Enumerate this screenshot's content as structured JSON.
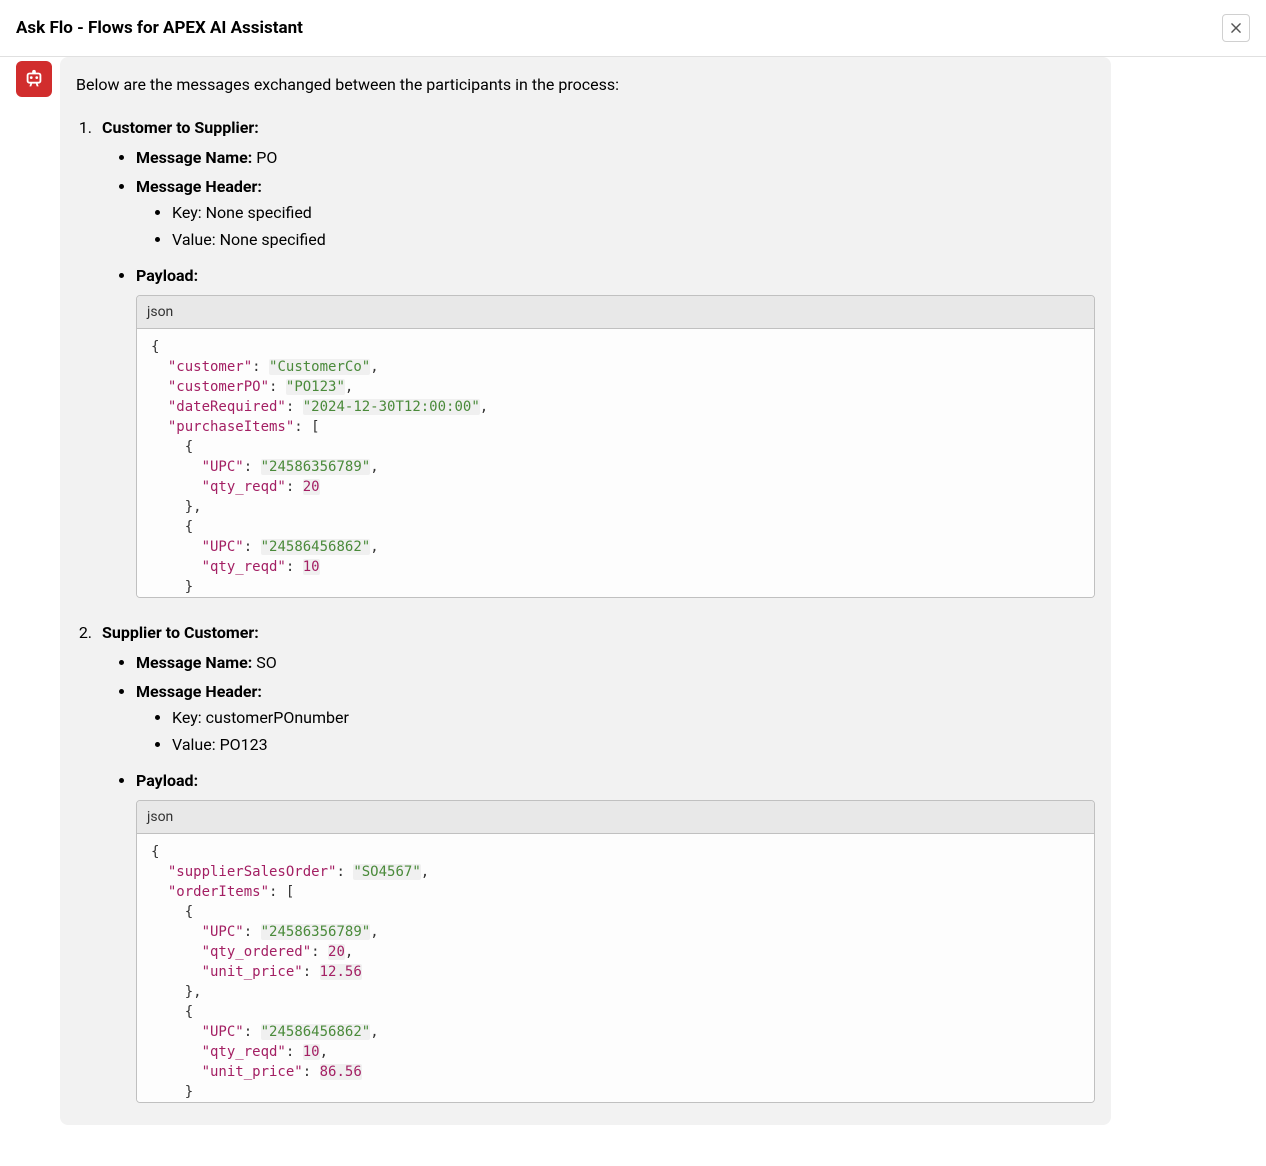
{
  "header": {
    "title": "Ask Flo - Flows for APEX AI Assistant"
  },
  "content": {
    "intro": "Below are the messages exchanged between the participants in the process:",
    "code_lang": "json",
    "labels": {
      "message_name": "Message Name:",
      "message_header": "Message Header:",
      "payload": "Payload:",
      "key_prefix": "Key:",
      "value_prefix": "Value:"
    },
    "messages": [
      {
        "title": "Customer to Supplier:",
        "name_value": "PO",
        "header_key": "None specified",
        "header_value": "None specified",
        "payload": {
          "customer": "CustomerCo",
          "customerPO": "PO123",
          "dateRequired": "2024-12-30T12:00:00",
          "purchaseItems": [
            {
              "UPC": "24586356789",
              "qty_reqd": 20
            },
            {
              "UPC": "24586456862",
              "qty_reqd": 10
            }
          ]
        }
      },
      {
        "title": "Supplier to Customer:",
        "name_value": "SO",
        "header_key": "customerPOnumber",
        "header_value": "PO123",
        "payload": {
          "supplierSalesOrder": "SO4567",
          "orderItems": [
            {
              "UPC": "24586356789",
              "qty_ordered": 20,
              "unit_price": 12.56
            },
            {
              "UPC": "24586456862",
              "qty_reqd": 10,
              "unit_price": 86.56
            }
          ]
        }
      }
    ]
  }
}
